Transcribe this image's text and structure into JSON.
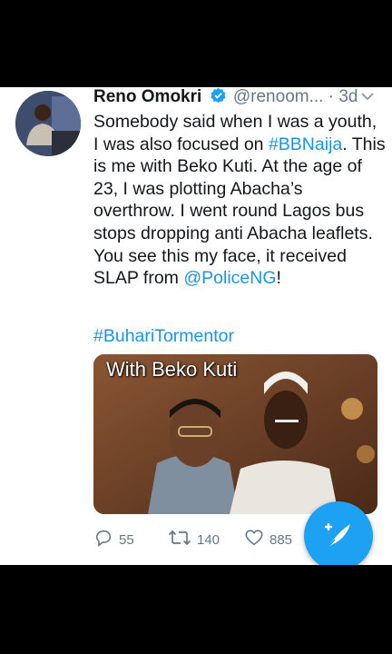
{
  "colors": {
    "accent": "#1da1f2",
    "link": "#1b95e0",
    "text": "#14171a",
    "muted": "#657786"
  },
  "tweet": {
    "author_name": "Reno Omokri",
    "handle": "@renoom...",
    "separator": "·",
    "time": "3d",
    "text_parts": {
      "t1": "Somebody said when I was a youth, I was also focused on ",
      "h1": "#BBNaija",
      "t2": ". This is me with Beko Kuti. At the age of 23, I was plotting Abacha’s overthrow. I went round Lagos bus stops dropping anti Abacha leaflets. You see this my face, it received SLAP from ",
      "m1": "@PoliceNG",
      "t3": "!"
    },
    "hashtag": "#BuhariTormentor",
    "media_caption": "With Beko Kuti",
    "replies": "55",
    "retweets": "140",
    "likes": "885"
  },
  "icons": {
    "verified": "verified-badge-icon",
    "more": "chevron-down-icon",
    "reply": "reply-icon",
    "retweet": "retweet-icon",
    "like": "heart-icon",
    "compose": "compose-tweet-icon"
  }
}
